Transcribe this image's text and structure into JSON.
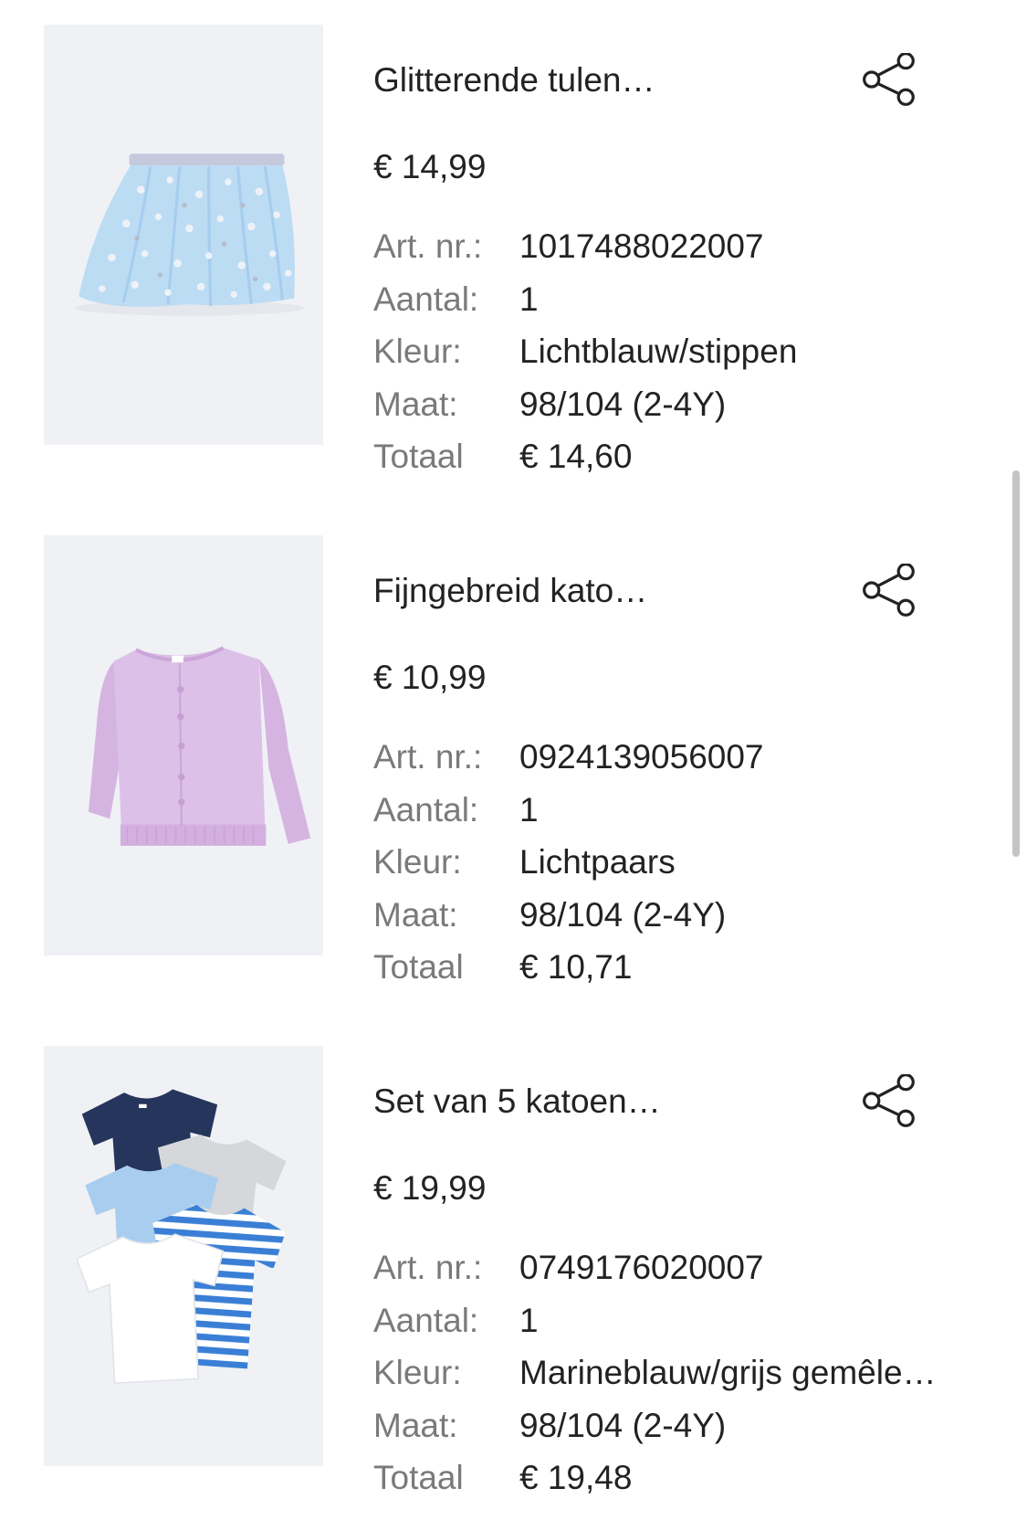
{
  "items": [
    {
      "title": "Glitterende tulen…",
      "price": "€ 14,99",
      "image": "tulle-skirt-photo",
      "details": [
        {
          "label": "Art. nr.:",
          "value": "1017488022007"
        },
        {
          "label": "Aantal:",
          "value": "1"
        },
        {
          "label": "Kleur:",
          "value": "Lichtblauw/stippen"
        },
        {
          "label": "Maat:",
          "value": "98/104 (2-4Y)"
        },
        {
          "label": "Totaal",
          "value": "€ 14,60"
        }
      ]
    },
    {
      "title": "Fijngebreid kato…",
      "price": "€ 10,99",
      "image": "cardigan-photo",
      "details": [
        {
          "label": "Art. nr.:",
          "value": "0924139056007"
        },
        {
          "label": "Aantal:",
          "value": "1"
        },
        {
          "label": "Kleur:",
          "value": "Lichtpaars"
        },
        {
          "label": "Maat:",
          "value": "98/104 (2-4Y)"
        },
        {
          "label": "Totaal",
          "value": "€ 10,71"
        }
      ]
    },
    {
      "title": "Set van 5 katoen…",
      "price": "€ 19,99",
      "image": "tshirt-set-photo",
      "details": [
        {
          "label": "Art. nr.:",
          "value": "0749176020007"
        },
        {
          "label": "Aantal:",
          "value": "1"
        },
        {
          "label": "Kleur:",
          "value": "Marineblauw/grijs gemêle…"
        },
        {
          "label": "Maat:",
          "value": "98/104 (2-4Y)"
        },
        {
          "label": "Totaal",
          "value": "€ 19,48"
        }
      ]
    }
  ],
  "icons": {
    "share": "share-icon"
  },
  "colors": {
    "text": "#222222",
    "muted": "#7a7a7a",
    "image_background": "#eff1f5",
    "scrollbar": "#c4c4c4"
  }
}
